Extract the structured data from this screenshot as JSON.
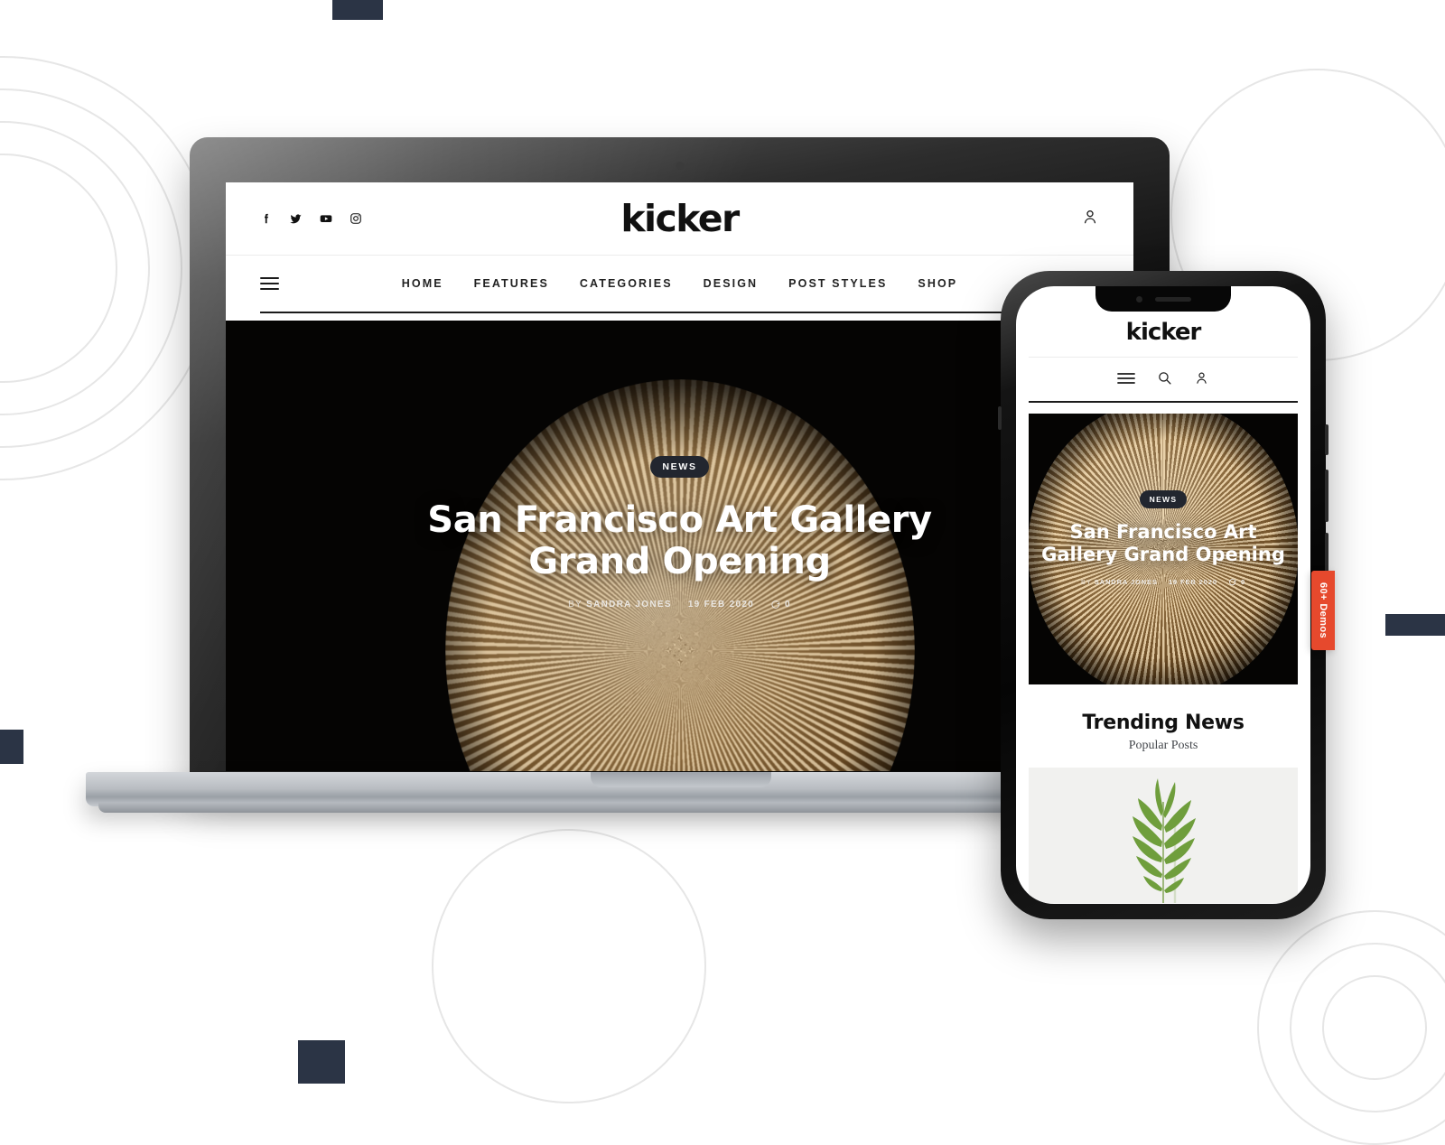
{
  "background": {
    "accent_square_color": "#2b3445",
    "ring_color": "#e6e6e6",
    "page_bg": "#ffffff"
  },
  "desktop": {
    "brand": "kicker",
    "socials": [
      {
        "name": "facebook-icon",
        "label": "Facebook"
      },
      {
        "name": "twitter-icon",
        "label": "Twitter"
      },
      {
        "name": "youtube-icon",
        "label": "YouTube"
      },
      {
        "name": "instagram-icon",
        "label": "Instagram"
      }
    ],
    "account_icon": "user-icon",
    "menu_icon": "hamburger-icon",
    "nav": [
      {
        "label": "HOME"
      },
      {
        "label": "FEATURES"
      },
      {
        "label": "CATEGORIES"
      },
      {
        "label": "DESIGN"
      },
      {
        "label": "POST STYLES"
      },
      {
        "label": "SHOP"
      }
    ],
    "hero": {
      "category": "NEWS",
      "title": "San Francisco Art Gallery Grand Opening",
      "by_prefix": "BY",
      "author": "SANDRA JONES",
      "date": "19 FEB 2020",
      "comments": "0",
      "comment_icon": "comment-bubble-icon"
    }
  },
  "phone": {
    "brand": "kicker",
    "icons": [
      {
        "name": "hamburger-icon"
      },
      {
        "name": "search-icon"
      },
      {
        "name": "user-icon"
      }
    ],
    "hero": {
      "category": "NEWS",
      "title": "San Francisco Art Gallery Grand Opening",
      "by_prefix": "BY",
      "author": "SANDRA JONES",
      "date": "19 FEB 2020",
      "comments": "0"
    },
    "section": {
      "heading": "Trending News",
      "subheading": "Popular Posts",
      "thumb_alt": "palm-frond-photo"
    }
  },
  "demos_tab": {
    "label": "60+ Demos",
    "color": "#e6492d"
  }
}
